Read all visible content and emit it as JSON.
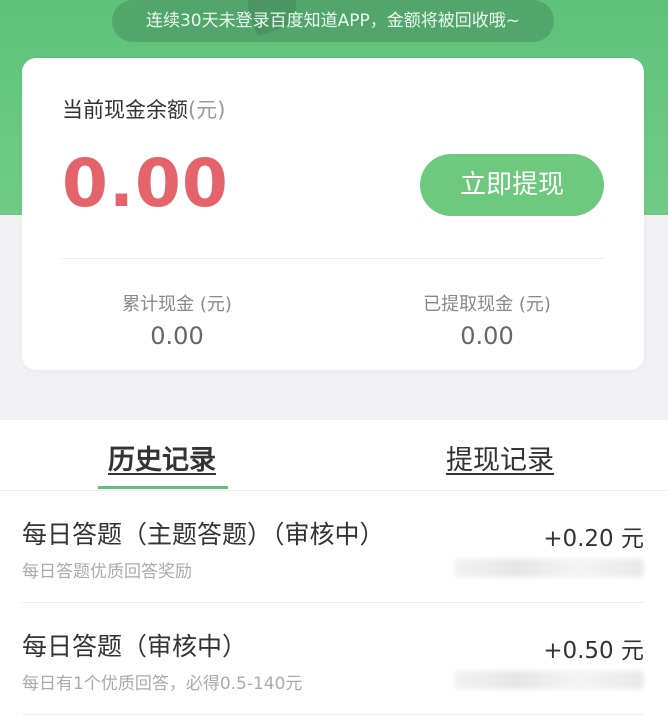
{
  "notice": {
    "text": "连续30天未登录百度知道APP，金额将被回收哦~"
  },
  "balance": {
    "label": "当前现金余额",
    "unit": "(元)",
    "amount": "0.00",
    "withdraw_label": "立即提现",
    "amount_color": "#e5646b",
    "accent_color": "#6cc97e"
  },
  "stats": {
    "total_label": "累计现金 (元)",
    "total_value": "0.00",
    "withdrawn_label": "已提取现金 (元)",
    "withdrawn_value": "0.00"
  },
  "tabs": [
    {
      "label": "历史记录",
      "active": true
    },
    {
      "label": "提现记录",
      "active": false
    }
  ],
  "records": [
    {
      "title": "每日答题（主题答题）（审核中）",
      "subtitle": "每日答题优质回答奖励",
      "amount": "+0.20 元"
    },
    {
      "title": "每日答题（审核中）",
      "subtitle": "每日有1个优质回答，必得0.5-140元",
      "amount": "+0.50 元"
    }
  ]
}
